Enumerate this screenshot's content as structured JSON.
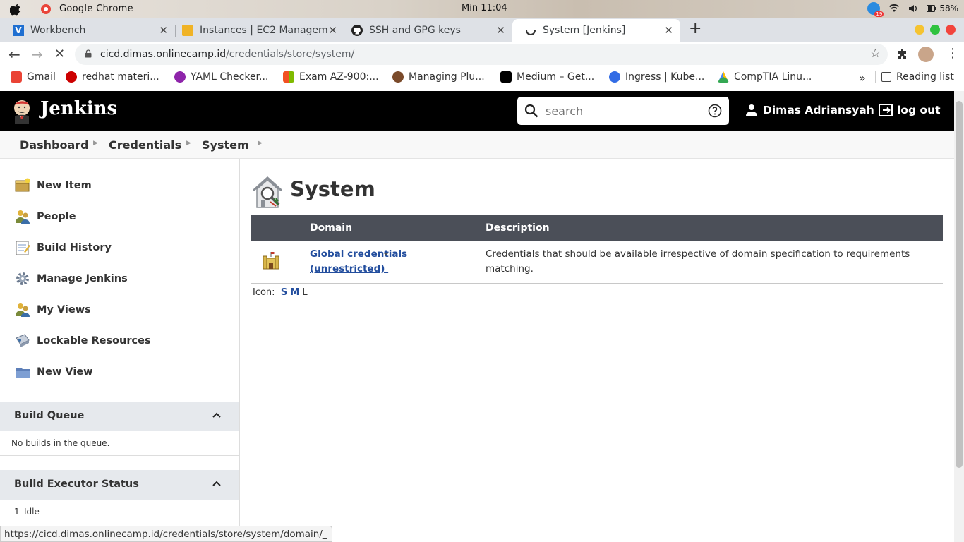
{
  "os": {
    "app_name": "Google Chrome",
    "clock": "Min 11:04",
    "notification_count": "19",
    "battery": "58%"
  },
  "tabs": [
    {
      "title": "Workbench",
      "icon": "vscode-icon"
    },
    {
      "title": "Instances | EC2 Manageme",
      "icon": "aws-icon"
    },
    {
      "title": "SSH and GPG keys",
      "icon": "github-icon"
    },
    {
      "title": "System [Jenkins]",
      "icon": "loading-spinner-icon",
      "active": true
    }
  ],
  "address": {
    "host": "cicd.dimas.onlinecamp.id",
    "path": "/credentials/store/system/"
  },
  "bookmarks": [
    {
      "label": "Gmail",
      "color": "#ea4335"
    },
    {
      "label": "redhat materi...",
      "color": "#cc0000"
    },
    {
      "label": "YAML Checker...",
      "color": "#8e24aa"
    },
    {
      "label": "Exam AZ-900:...",
      "color": "#f25022"
    },
    {
      "label": "Managing Plu...",
      "color": "#7a4a2a"
    },
    {
      "label": "Medium – Get...",
      "color": "#000000"
    },
    {
      "label": "Ingress | Kube...",
      "color": "#326ce5"
    },
    {
      "label": "CompTIA Linu...",
      "color": "#fbbc04"
    }
  ],
  "bookmarks_overflow": "»",
  "reading_list": "Reading list",
  "jenkins": {
    "title": "Jenkins",
    "search_placeholder": "search",
    "user": "Dimas Adriansyah",
    "logout": "log out"
  },
  "breadcrumb": [
    "Dashboard",
    "Credentials",
    "System"
  ],
  "sidebar": {
    "tasks": [
      {
        "label": "New Item",
        "icon": "new-item-icon"
      },
      {
        "label": "People",
        "icon": "people-icon"
      },
      {
        "label": "Build History",
        "icon": "build-history-icon"
      },
      {
        "label": "Manage Jenkins",
        "icon": "gear-icon"
      },
      {
        "label": "My Views",
        "icon": "my-views-icon"
      },
      {
        "label": "Lockable Resources",
        "icon": "lockable-resources-icon"
      },
      {
        "label": "New View",
        "icon": "folder-icon"
      }
    ],
    "build_queue": {
      "title": "Build Queue",
      "body": "No builds in the queue."
    },
    "executor": {
      "title": "Build Executor Status",
      "num": "1",
      "state": "Idle"
    }
  },
  "main": {
    "title": "System",
    "columns": {
      "domain": "Domain",
      "description": "Description"
    },
    "rows": [
      {
        "domain_line1": "Global credentials",
        "domain_line2": "(unrestricted)",
        "description_line1": "Credentials that should be available irrespective of domain specification to requirements",
        "description_line2": "matching."
      }
    ],
    "icon_size": {
      "label": "Icon:",
      "s": "S",
      "m": "M",
      "l": "L"
    }
  },
  "status_url": "https://cicd.dimas.onlinecamp.id/credentials/store/system/domain/_"
}
